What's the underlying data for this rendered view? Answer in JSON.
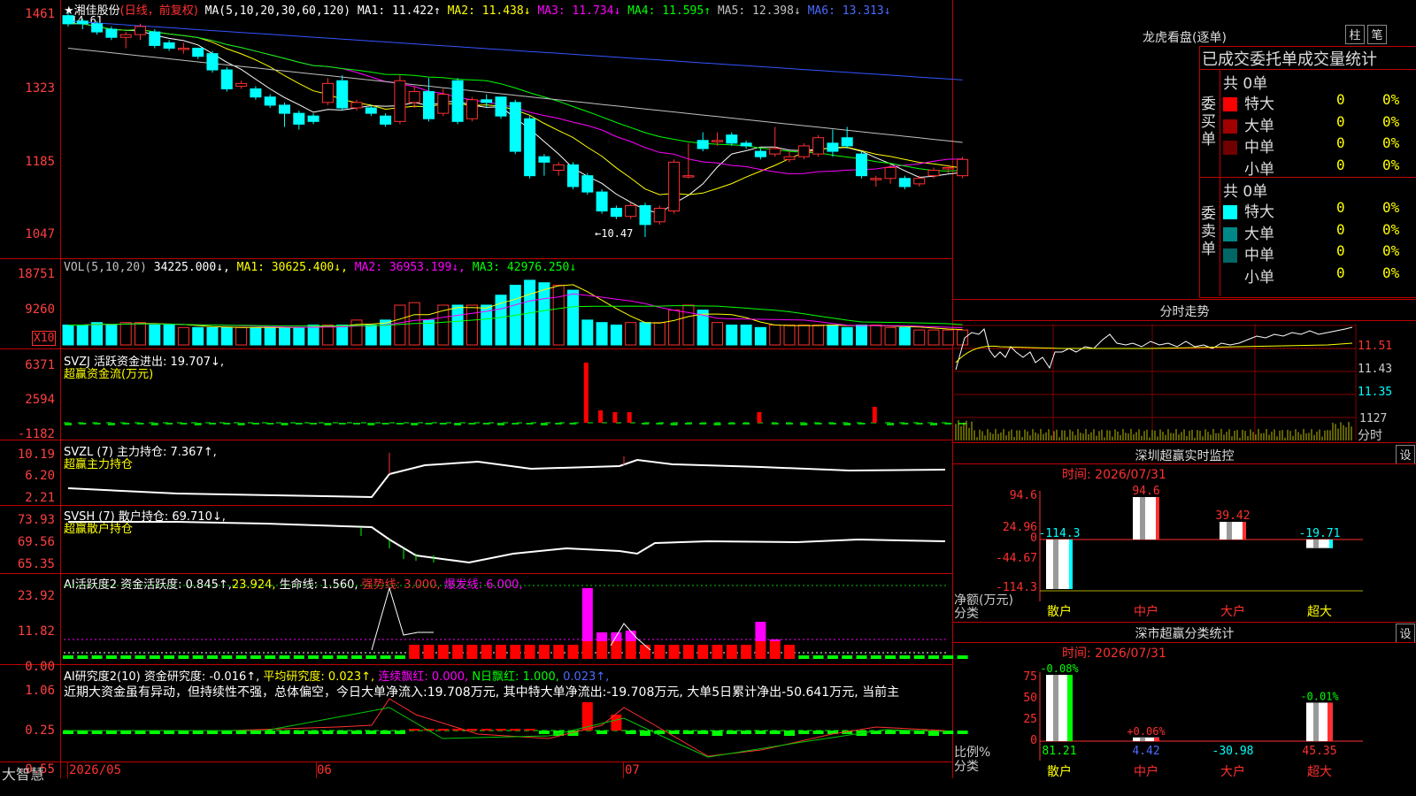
{
  "main_chart": {
    "stock_name": "湘佳股份",
    "period": "(日线，前复权)",
    "ma_label": "MA(5,10,20,30,60,120)",
    "ma_values": [
      {
        "name": "MA1:",
        "value": "11.422",
        "arrow": "↑",
        "color": "#ffffff"
      },
      {
        "name": "MA2:",
        "value": "11.438",
        "arrow": "↓",
        "color": "#ffff00"
      },
      {
        "name": "MA3:",
        "value": "11.734",
        "arrow": "↓",
        "color": "#ff00ff"
      },
      {
        "name": "MA4:",
        "value": "11.595",
        "arrow": "↑",
        "color": "#00ff00"
      },
      {
        "name": "MA5:",
        "value": "12.398",
        "arrow": "↓",
        "color": "#c0c0c0"
      },
      {
        "name": "MA6:",
        "value": "13.313",
        "arrow": "↓",
        "color": "#4a6bff"
      }
    ],
    "high_marker": "14.61",
    "low_marker": "←10.47",
    "y_ticks": [
      "1461",
      "1323",
      "1185",
      "1047"
    ]
  },
  "vol_panel": {
    "label": "VOL(5,10,20)",
    "values": [
      {
        "text": "34225.000↓,",
        "color": "#ffffff"
      },
      {
        "text": "MA1: 30625.400↓,",
        "color": "#ffff00"
      },
      {
        "text": "MA2: 36953.199↓,",
        "color": "#ff00ff"
      },
      {
        "text": "MA3: 42976.250↓",
        "color": "#00ff00"
      }
    ],
    "y_ticks": [
      "18751",
      "9260"
    ],
    "unit": "X10"
  },
  "svzj_panel": {
    "label": "SVZJ  活跃资金进出: 19.707↓,",
    "sub": "超赢资金流(万元)",
    "y_ticks": [
      "6371",
      "2594",
      "-1182"
    ]
  },
  "svzl_panel": {
    "label": "SVZL (7) 主力持仓: 7.367↑,",
    "sub": "超赢主力持仓",
    "y_ticks": [
      "10.19",
      "6.20",
      "2.21"
    ]
  },
  "svsh_panel": {
    "label": "SVSH (7) 散户持仓: 69.710↓,",
    "sub": "超赢散户持仓",
    "y_ticks": [
      "73.93",
      "69.56",
      "65.35"
    ]
  },
  "ai_active_panel": {
    "label": "AI活跃度2 资金活跃度: 0.845↑,",
    "v2": "23.924,",
    "v3": "生命线: 1.560,",
    "v4": "强势线: 3.000,",
    "v5": "爆发线: 6.000,",
    "y_ticks": [
      "23.92",
      "11.82",
      "0.00"
    ]
  },
  "ai_research_panel": {
    "label": "AI研究度2(10) 资金研究度: -0.016↑,",
    "v2": "平均研究度: 0.023↑,",
    "v3": "连续飘红: 0.000,",
    "v4": "N日飘红: 1.000,",
    "v5": "0.023↑,",
    "comment": "近期大资金虽有异动，但持续性不强，总体偏空，今日大单净流入:19.708万元, 其中特大单净流出:-19.708万元, 大单5日累计净出-50.641万元, 当前主",
    "y_ticks": [
      "1.06",
      "0.25",
      "-0.55"
    ]
  },
  "bottom_bar": {
    "brand": "大智慧",
    "dates": [
      "2026/05",
      "06",
      "07"
    ]
  },
  "right_panel": {
    "lhb_title": "龙虎看盘(逐单)",
    "btn_bar": "柱",
    "btn_pen": "笔",
    "stats_title": "已成交委托单成交量统计",
    "buy_section": {
      "side_label": "委买单",
      "total": "共 0单",
      "rows": [
        {
          "label": "特大",
          "color": "#ff0000",
          "count": "0",
          "pct": "0%"
        },
        {
          "label": "大单",
          "color": "#a00000",
          "count": "0",
          "pct": "0%"
        },
        {
          "label": "中单",
          "color": "#700000",
          "count": "0",
          "pct": "0%"
        },
        {
          "label": "小单",
          "color": "#000000",
          "count": "0",
          "pct": "0%"
        }
      ]
    },
    "sell_section": {
      "side_label": "委卖单",
      "total": "共 0单",
      "rows": [
        {
          "label": "特大",
          "color": "#00ffff",
          "count": "0",
          "pct": "0%"
        },
        {
          "label": "大单",
          "color": "#008888",
          "count": "0",
          "pct": "0%"
        },
        {
          "label": "中单",
          "color": "#006666",
          "count": "0",
          "pct": "0%"
        },
        {
          "label": "小单",
          "color": "#000000",
          "count": "0",
          "pct": "0%"
        }
      ]
    },
    "intraday": {
      "title": "分时走势",
      "y_ticks": [
        "11.51",
        "11.43",
        "11.35"
      ],
      "vol_tick": "1127",
      "vol_unit": "分时"
    },
    "sz_monitor": {
      "title": "深圳超赢实时监控",
      "set_btn": "设",
      "time": "时间: 2026/07/31",
      "y_ticks": [
        "94.6",
        "24.96",
        "0",
        "-44.67",
        "-114.3"
      ],
      "axis_title": "净额(万元)",
      "axis_sub": "分类",
      "bars": [
        {
          "cat": "散户",
          "value": -114.3,
          "label": "-114.3",
          "cat_color": "#ffff00"
        },
        {
          "cat": "中户",
          "value": 94.6,
          "label": "94.6",
          "cat_color": "#ff3030"
        },
        {
          "cat": "大户",
          "value": 39.42,
          "label": "39.42",
          "cat_color": "#ff3030"
        },
        {
          "cat": "超大",
          "value": -19.71,
          "label": "-19.71",
          "cat_color": "#ffff00"
        }
      ]
    },
    "sz_class": {
      "title": "深市超赢分类统计",
      "set_btn": "设",
      "time": "时间: 2026/07/31",
      "y_ticks": [
        "75",
        "50",
        "25",
        "0"
      ],
      "axis_title": "比例%",
      "axis_sub": "分类",
      "bars": [
        {
          "cat": "散户",
          "top_label": "-0.08%",
          "value": 81.21,
          "bottom": "81.21",
          "cat_color": "#ffff00"
        },
        {
          "cat": "中户",
          "top_label": "+0.06%",
          "value": 4.42,
          "bottom": "4.42",
          "cat_color": "#ff3030"
        },
        {
          "cat": "大户",
          "top_label": "",
          "value": -30.98,
          "bottom": "-30.98",
          "cat_color": "#ff3030"
        },
        {
          "cat": "超大",
          "top_label": "-0.01%",
          "value": 45.35,
          "bottom": "45.35",
          "cat_color": "#ff3030"
        }
      ]
    }
  },
  "chart_data": [
    {
      "type": "candlestick",
      "title": "湘佳股份 日线",
      "ylim": [
        10.47,
        14.61
      ],
      "x": [
        1,
        2,
        3,
        4,
        5,
        6,
        7,
        8,
        9,
        10,
        11,
        12,
        13,
        14,
        15,
        16,
        17,
        18,
        19,
        20,
        21,
        22,
        23,
        24,
        25,
        26,
        27,
        28,
        29,
        30,
        31,
        32,
        33,
        34,
        35,
        36,
        37,
        38,
        39,
        40,
        41,
        42,
        43,
        44,
        45,
        46,
        47,
        48,
        49,
        50,
        51,
        52,
        53,
        54,
        55,
        56,
        57,
        58,
        59,
        60,
        61,
        62,
        63
      ],
      "open": [
        14.55,
        14.45,
        14.4,
        14.3,
        14.15,
        14.2,
        14.25,
        14.05,
        13.95,
        13.95,
        13.85,
        13.55,
        13.25,
        13.2,
        13.05,
        12.9,
        12.75,
        12.7,
        12.95,
        13.35,
        12.85,
        12.85,
        12.7,
        12.6,
        12.95,
        13.15,
        12.75,
        13.35,
        12.65,
        13.0,
        13.05,
        12.95,
        12.65,
        11.95,
        11.7,
        11.8,
        11.6,
        11.3,
        11.0,
        10.85,
        11.05,
        10.75,
        10.95,
        11.6,
        12.25,
        12.25,
        12.35,
        12.2,
        12.05,
        12.0,
        11.9,
        11.95,
        12.0,
        12.2,
        12.3,
        12.0,
        11.55,
        11.55,
        11.55,
        11.45,
        11.6,
        11.75,
        11.6
      ],
      "close": [
        14.4,
        14.4,
        14.25,
        14.15,
        14.2,
        14.35,
        14.0,
        13.95,
        13.95,
        13.8,
        13.55,
        13.2,
        13.3,
        13.05,
        12.9,
        12.75,
        12.55,
        12.6,
        13.3,
        12.85,
        12.95,
        12.75,
        12.55,
        13.35,
        13.15,
        12.65,
        13.1,
        12.6,
        13.0,
        12.95,
        12.7,
        12.05,
        11.6,
        11.85,
        11.8,
        11.4,
        11.3,
        10.95,
        10.85,
        11.05,
        10.7,
        11.0,
        11.85,
        11.6,
        12.1,
        12.25,
        12.2,
        12.15,
        11.95,
        12.1,
        11.95,
        12.15,
        12.3,
        12.05,
        12.15,
        11.6,
        11.55,
        11.75,
        11.4,
        11.55,
        11.7,
        11.75,
        11.9
      ],
      "high": [
        14.61,
        14.5,
        14.45,
        14.35,
        14.25,
        14.4,
        14.3,
        14.1,
        14.05,
        13.95,
        13.9,
        13.6,
        13.35,
        13.25,
        13.1,
        12.95,
        12.8,
        12.75,
        13.4,
        13.45,
        13.0,
        12.9,
        12.75,
        13.45,
        13.25,
        13.4,
        13.2,
        13.4,
        13.05,
        13.1,
        13.05,
        13.0,
        12.7,
        12.0,
        11.85,
        11.85,
        11.65,
        11.35,
        11.05,
        11.1,
        11.1,
        11.05,
        11.9,
        12.2,
        12.4,
        12.4,
        12.4,
        12.25,
        12.1,
        12.5,
        12.05,
        12.2,
        12.35,
        12.45,
        12.5,
        12.05,
        11.6,
        11.8,
        11.6,
        11.6,
        11.75,
        11.8,
        11.95
      ],
      "low": [
        14.35,
        14.3,
        14.2,
        14.1,
        13.95,
        14.1,
        13.95,
        13.9,
        13.85,
        13.75,
        13.5,
        13.15,
        13.2,
        13.0,
        12.85,
        12.5,
        12.45,
        12.55,
        12.9,
        12.8,
        12.8,
        12.7,
        12.5,
        12.55,
        12.85,
        12.6,
        12.7,
        12.55,
        12.6,
        12.85,
        12.65,
        12.0,
        11.55,
        11.6,
        11.6,
        11.35,
        11.25,
        10.9,
        10.8,
        10.8,
        10.47,
        10.7,
        10.9,
        11.55,
        12.05,
        12.15,
        12.15,
        12.1,
        11.9,
        11.95,
        11.85,
        11.9,
        11.95,
        11.95,
        12.1,
        11.55,
        11.4,
        11.45,
        11.35,
        11.4,
        11.55,
        11.65,
        11.55
      ]
    },
    {
      "type": "bar",
      "title": "深圳超赢实时监控",
      "categories": [
        "散户",
        "中户",
        "大户",
        "超大"
      ],
      "values": [
        -114.3,
        94.6,
        39.42,
        -19.71
      ],
      "ylabel": "净额(万元)",
      "ylim": [
        -114.3,
        94.6
      ]
    },
    {
      "type": "bar",
      "title": "深市超赢分类统计",
      "categories": [
        "散户",
        "中户",
        "大户",
        "超大"
      ],
      "values": [
        81.21,
        4.42,
        -30.98,
        45.35
      ],
      "ylabel": "比例%",
      "ylim": [
        0,
        75
      ]
    }
  ]
}
